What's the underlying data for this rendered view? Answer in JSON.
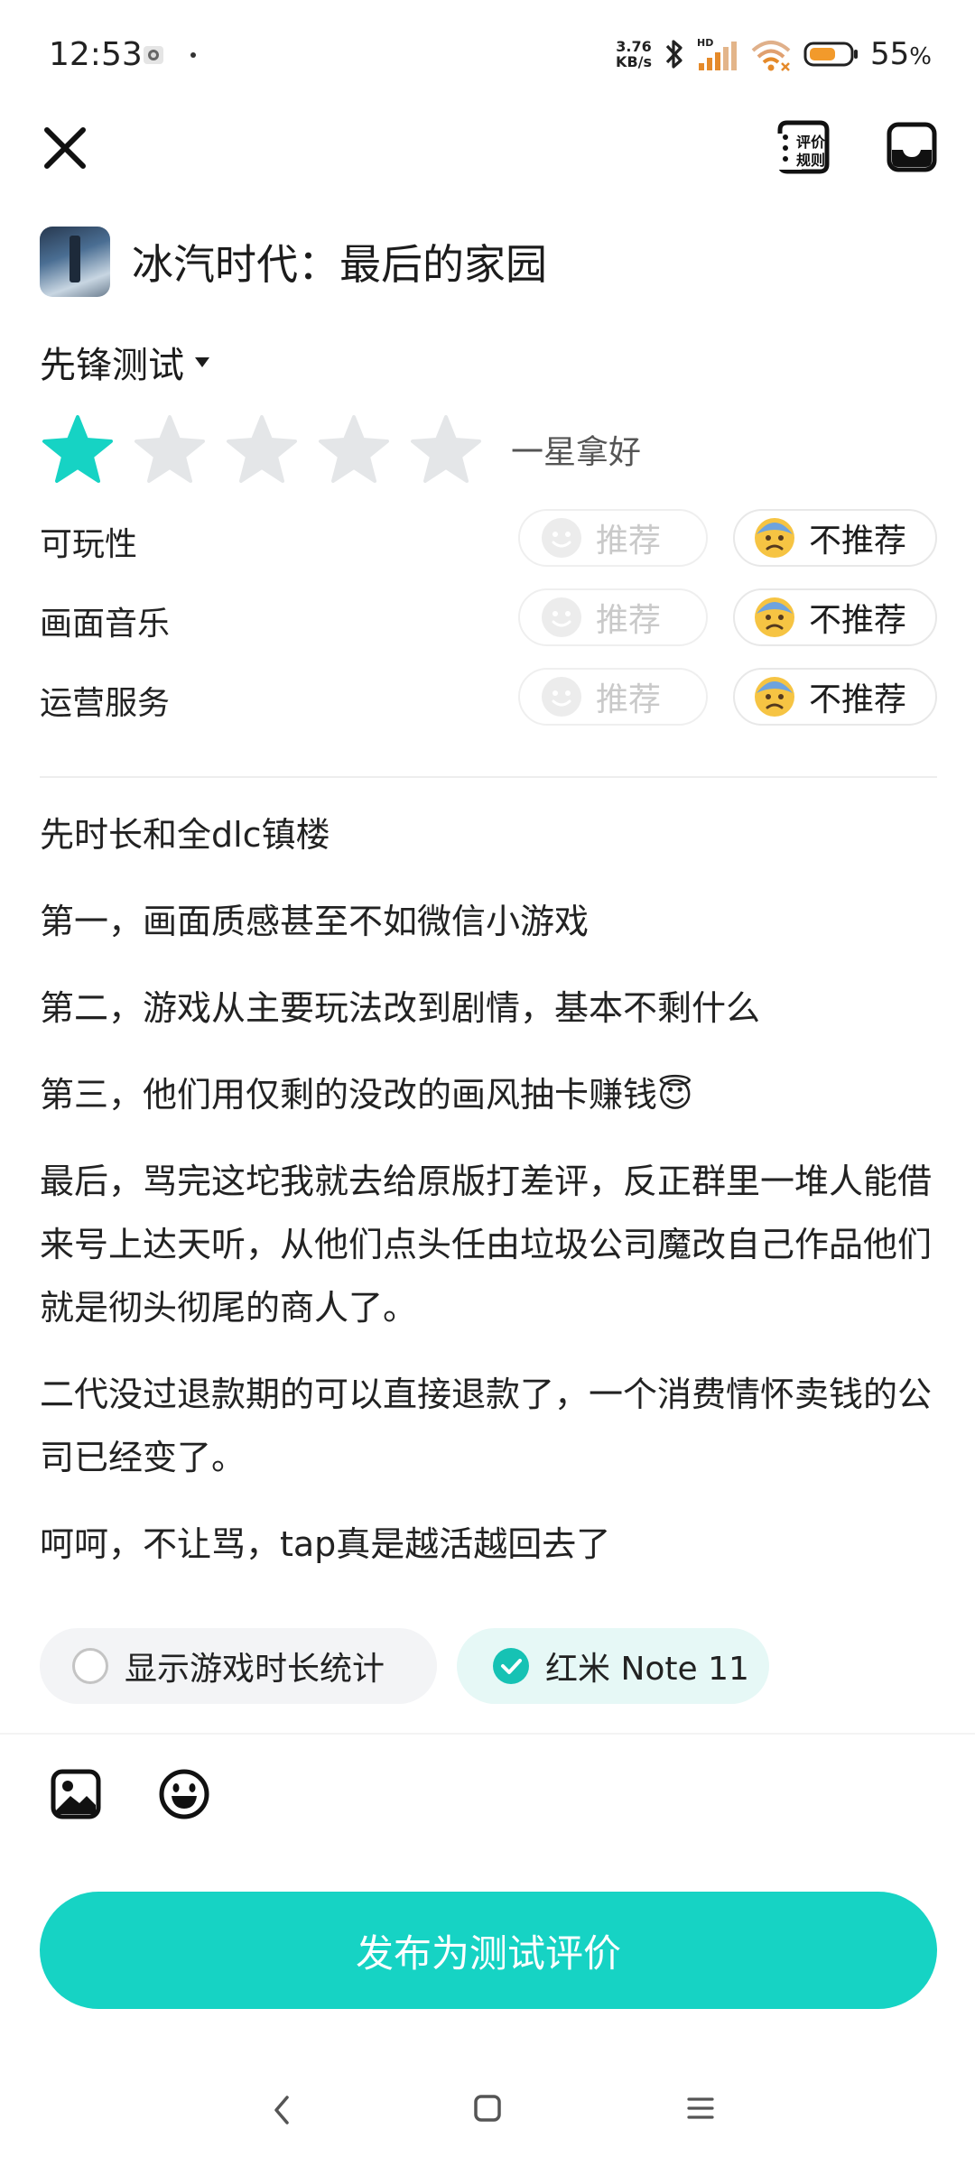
{
  "status_bar": {
    "time": "12:53",
    "net_speed_value": "3.76",
    "net_speed_unit": "KB/s",
    "battery_percent": "55",
    "battery_symbol": "%",
    "icons": [
      "photo-notification-icon",
      "dot-icon",
      "bluetooth-icon",
      "signal-icon",
      "wifi-icon",
      "battery-icon"
    ]
  },
  "header": {
    "close_icon": "close-icon",
    "rules_icon_text_1": "评价",
    "rules_icon_text_2": "规则",
    "draft_icon": "draft-box-icon"
  },
  "game": {
    "title": "冰汽时代：最后的家园",
    "icon": "game-icon"
  },
  "version": {
    "label": "先锋测试"
  },
  "rating": {
    "value": 1,
    "max": 5,
    "text": "一星拿好",
    "active_color": "#16d3c4",
    "inactive_color": "#e4e6e8"
  },
  "aspects": [
    {
      "label": "可玩性",
      "recommend": "推荐",
      "not_recommend": "不推荐",
      "selected": "not_recommend"
    },
    {
      "label": "画面音乐",
      "recommend": "推荐",
      "not_recommend": "不推荐",
      "selected": "not_recommend"
    },
    {
      "label": "运营服务",
      "recommend": "推荐",
      "not_recommend": "不推荐",
      "selected": "not_recommend"
    }
  ],
  "review": {
    "paragraphs": [
      "先时长和全dlc镇楼",
      "第一，画面质感甚至不如微信小游戏",
      "第二，游戏从主要玩法改到剧情，基本不剩什么",
      "第三，他们用仅剩的没改的画风抽卡赚钱😇",
      "最后，骂完这坨我就去给原版打差评，反正群里一堆人能借来号上达天听，从他们点头任由垃圾公司魔改自己作品他们就是彻头彻尾的商人了。",
      "二代没过退款期的可以直接退款了，一个消费情怀卖钱的公司已经变了。",
      "呵呵，不让骂，tap真是越活越回去了"
    ]
  },
  "options": {
    "show_playtime": {
      "label": "显示游戏时长统计",
      "checked": false
    },
    "device": {
      "label": "红米 Note 11",
      "checked": true
    }
  },
  "toolbar": {
    "image_icon": "image-icon",
    "emoji_icon": "emoji-icon"
  },
  "publish": {
    "label": "发布为测试评价",
    "color": "#16d3c4"
  },
  "nav": {
    "back_icon": "back-icon",
    "home_icon": "home-icon",
    "menu_icon": "menu-icon"
  }
}
